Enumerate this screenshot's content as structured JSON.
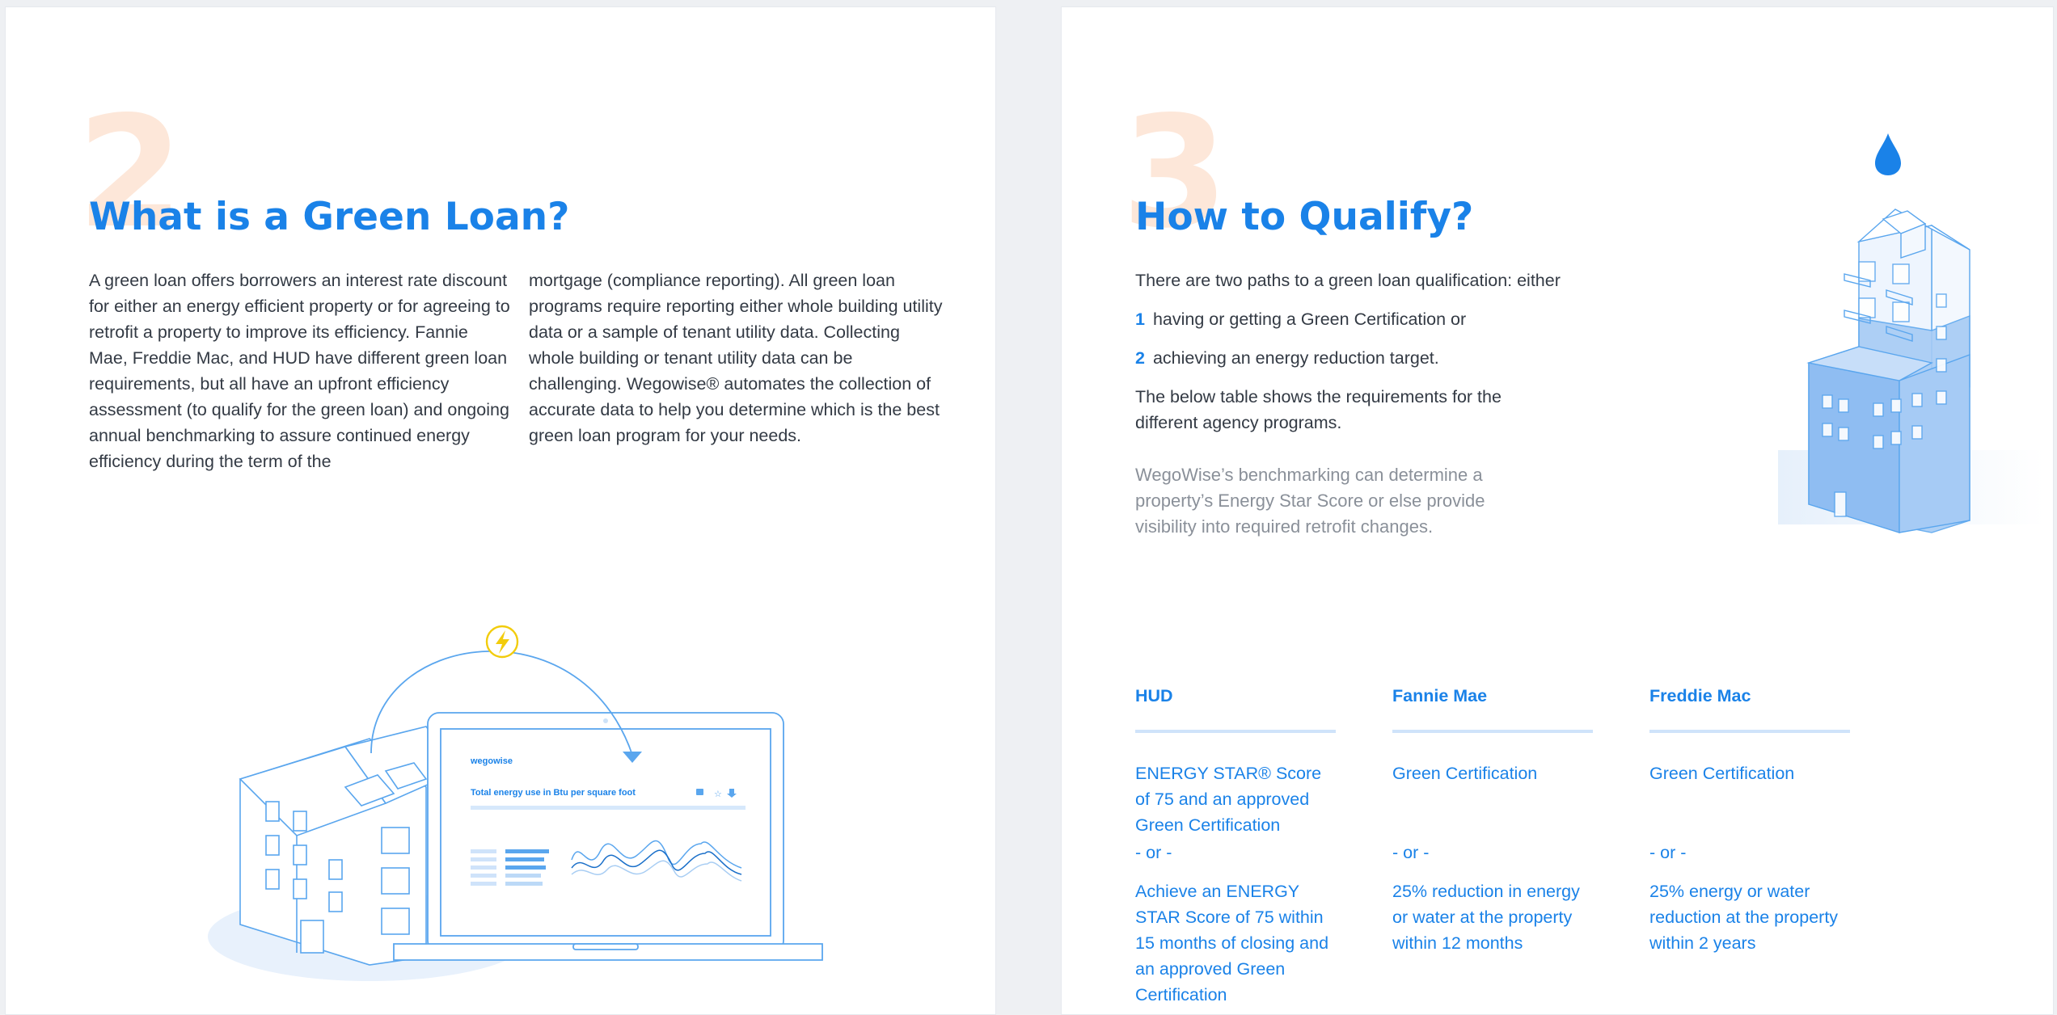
{
  "left_page": {
    "number": "2",
    "title": "What is a Green Loan?",
    "paragraph_col1": "A green loan offers borrowers an interest rate discount for either an energy efficient property or for agreeing to retrofit a property to improve its efficiency. Fannie Mae, Freddie Mac, and HUD have different green loan requirements, but all have an upfront efficiency assessment (to qualify for the green loan) and ongoing annual benchmarking to assure continued energy efficiency during the term of the",
    "paragraph_col2": "mortgage (compliance reporting). All green loan programs require reporting either whole building utility data or a sample of tenant utility data. Collecting whole building or tenant utility data can be challenging. Wegowise® automates the collection of accurate data to help you determine which is the best green loan program for your needs.",
    "illustration": {
      "laptop_brand": "wegowise",
      "laptop_chart_title": "Total energy use in Btu per square foot",
      "icons": [
        "lightning-icon",
        "building-icon",
        "laptop-icon"
      ]
    }
  },
  "right_page": {
    "number": "3",
    "title": "How to Qualify?",
    "intro": "There are two paths to a green loan qualification: either",
    "paths": [
      {
        "num": "1",
        "text": "having or getting a Green Certification or"
      },
      {
        "num": "2",
        "text": "achieving an energy reduction target."
      }
    ],
    "table_intro": "The below table shows the requirements for the different agency programs.",
    "note": "WegoWise’s benchmarking can determine a property’s Energy Star Score or else provide visibility into required retrofit changes.",
    "illustration_icons": [
      "water-drop-icon",
      "building-icon"
    ],
    "programs": [
      {
        "name": "HUD",
        "option1": "ENERGY STAR® Score of 75 and an approved Green Certification",
        "separator": " - or -",
        "option2": "Achieve an ENERGY STAR Score of 75 within 15 months of closing and an approved Green Certification"
      },
      {
        "name": "Fannie Mae",
        "option1": "Green Certification",
        "separator": "- or -",
        "option2": "25% reduction in energy or water at the property within 12 months"
      },
      {
        "name": "Freddie Mac",
        "option1": "Green Certification",
        "separator": "- or -",
        "option2": "25% energy or water reduction at the property within 2 years"
      }
    ]
  },
  "colors": {
    "accent_blue": "#1a82e8",
    "number_peach": "#fde7d9",
    "body_text": "#333a44",
    "muted_text": "#8a9099",
    "rule_blue": "#cfe3fa",
    "lightning_yellow": "#f2cc0c"
  }
}
